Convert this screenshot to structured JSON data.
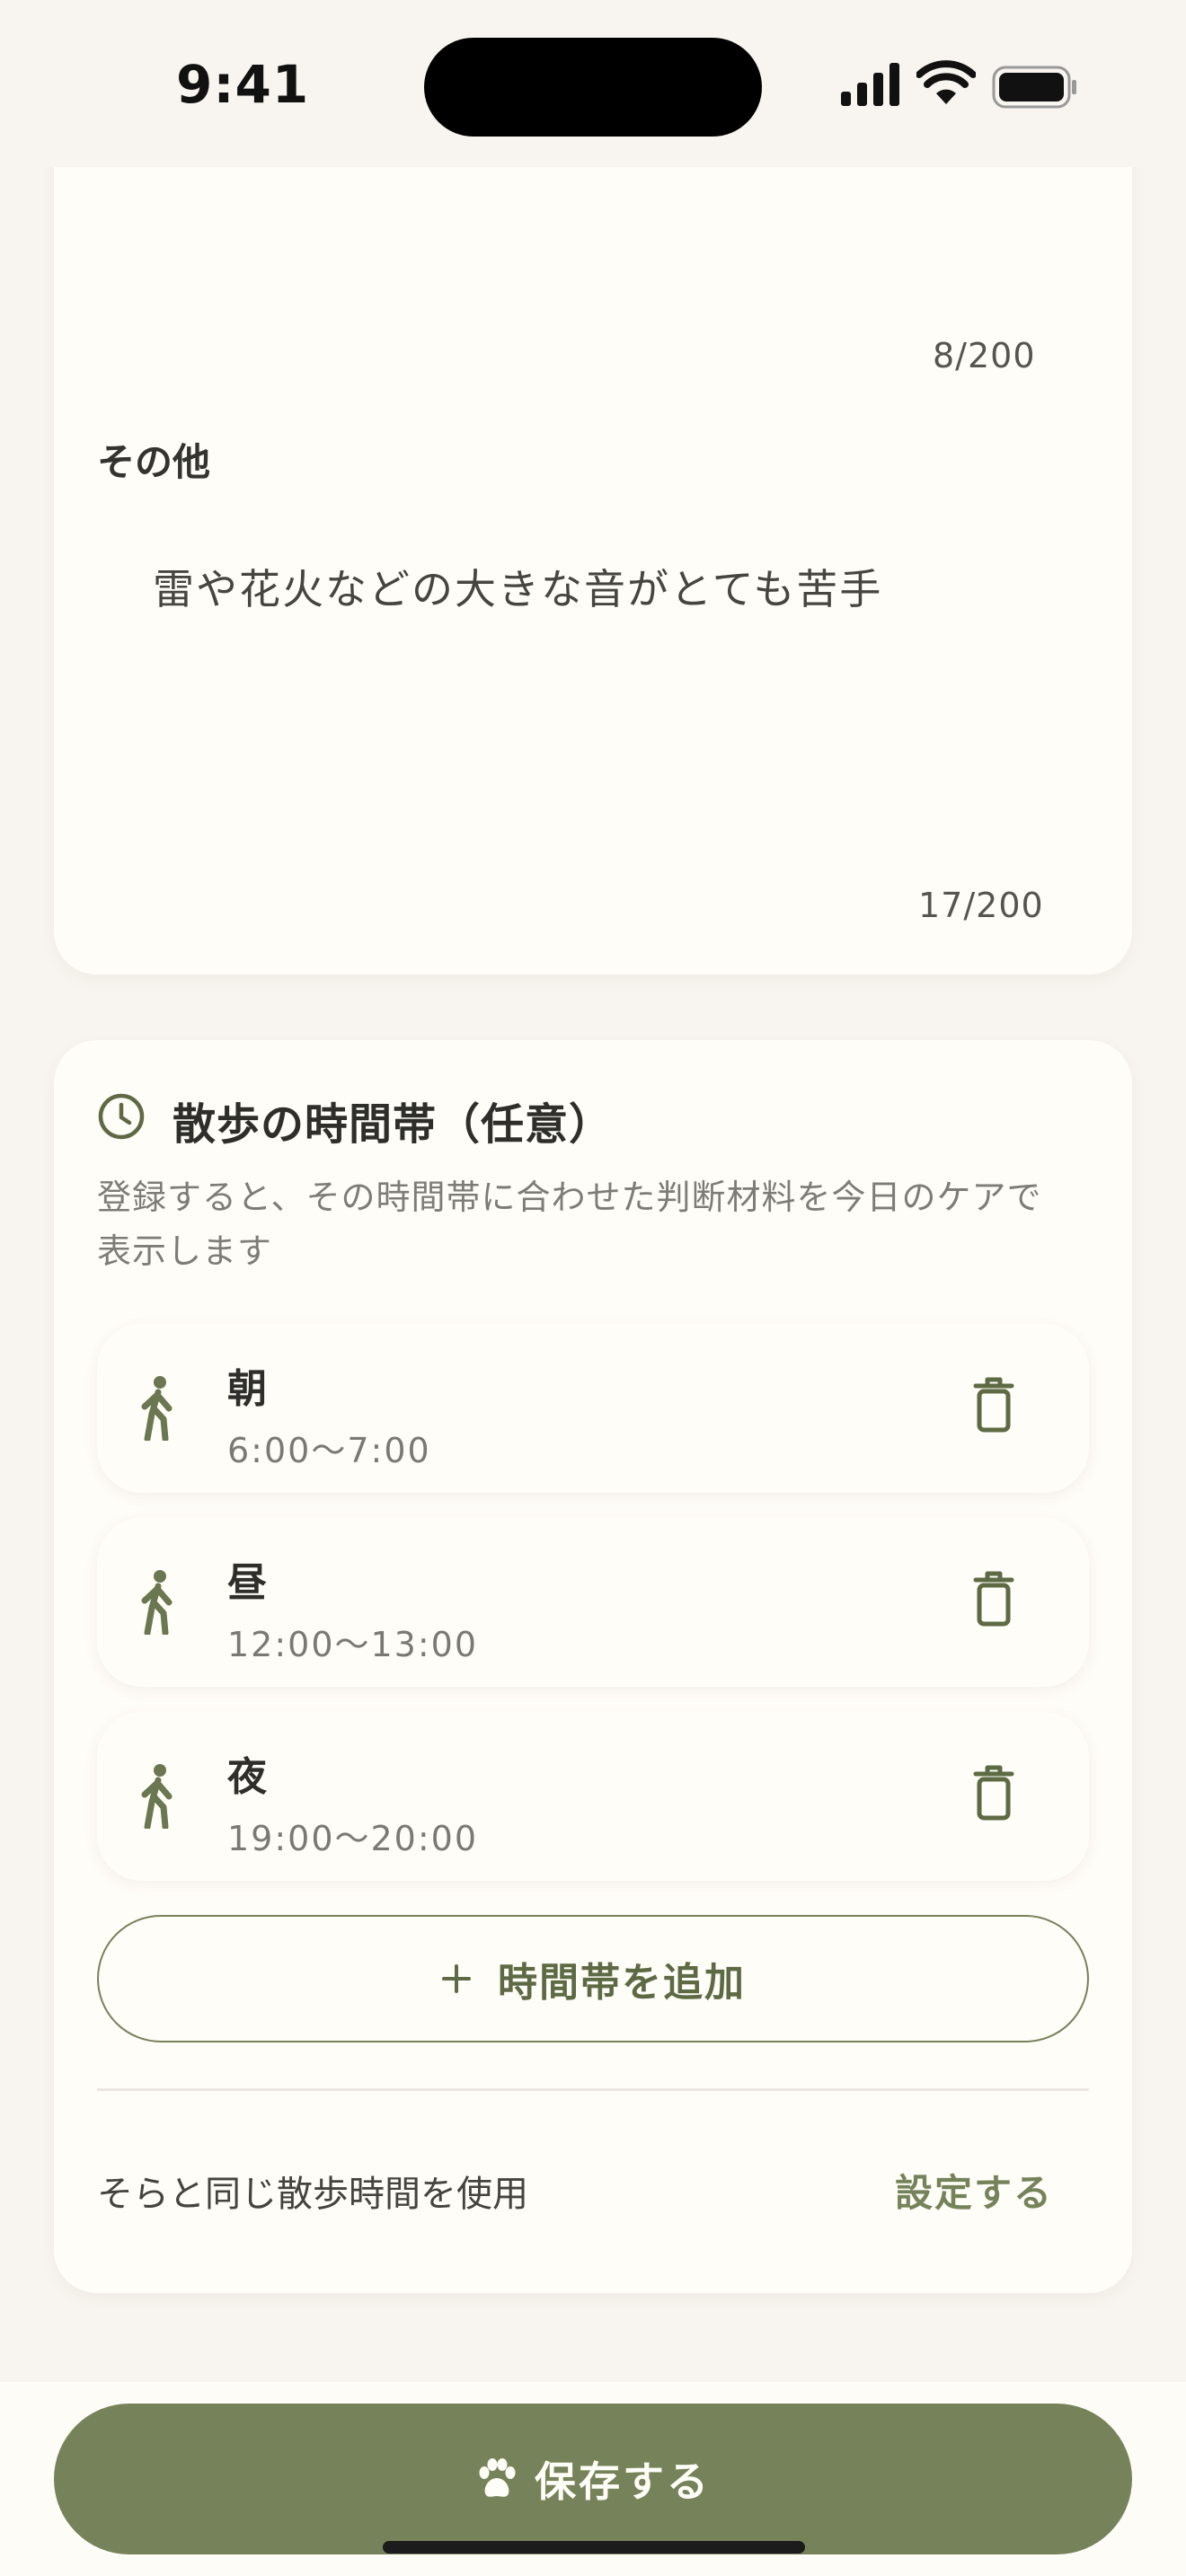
{
  "status_bar": {
    "time": "9:41"
  },
  "top_card": {
    "prev_counter": "8/200",
    "other_label": "その他",
    "other_value": "雷や花火などの大きな音がとても苦手",
    "other_counter": "17/200"
  },
  "walk_section": {
    "title": "散歩の時間帯（任意）",
    "desc_line1": "登録すると、その時間帯に合わせた判断材料を今日のケアで",
    "desc_line2": "表示します",
    "slots": [
      {
        "name": "朝",
        "time": "6:00〜7:00"
      },
      {
        "name": "昼",
        "time": "12:00〜13:00"
      },
      {
        "name": "夜",
        "time": "19:00〜20:00"
      }
    ],
    "add_label": "時間帯を追加",
    "share_label": "そらと同じ散歩時間を使用",
    "share_action": "設定する"
  },
  "footer": {
    "save_label": "保存する"
  },
  "icons": {
    "clock": "clock-icon",
    "walk": "walking-person-icon",
    "trash": "trash-icon",
    "plus": "plus-icon",
    "paw": "paw-icon"
  },
  "colors": {
    "accent": "#76835a",
    "background": "#f8f5f0",
    "card": "#fffdf8"
  }
}
